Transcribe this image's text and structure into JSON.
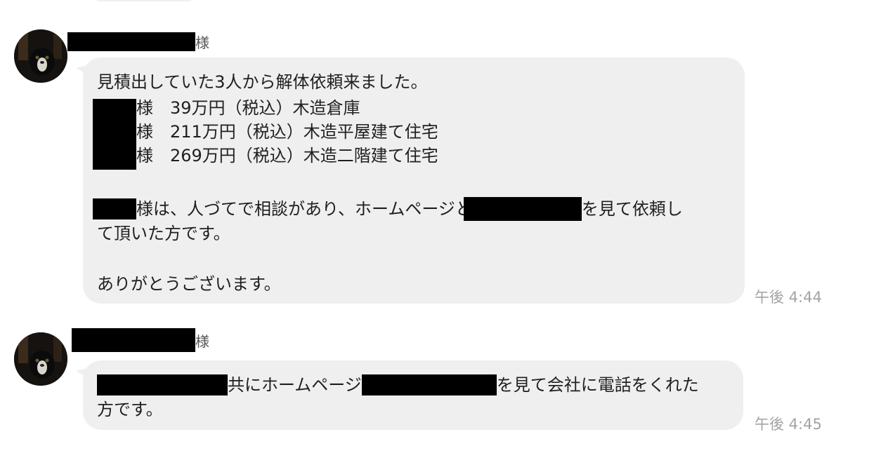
{
  "messages": [
    {
      "sender_suffix": "様",
      "lines": {
        "l1": "見積出していた3人から解体依頼来ました。",
        "l2": "様　39万円（税込）木造倉庫",
        "l3": "様　211万円（税込）木造平屋建て住宅",
        "l4": "様　269万円（税込）木造二階建て住宅",
        "l5a": "様は、人づてで相談があり、ホームページと",
        "l5b": "を見て依頼し",
        "l6": "て頂いた方です。",
        "l7": "ありがとうございます。"
      },
      "time": "午後 4:44"
    },
    {
      "sender_suffix": "様",
      "lines": {
        "l1a": "共にホームページ",
        "l1b": "を見て会社に電話をくれた",
        "l2": "方です。"
      },
      "time": "午後 4:45"
    }
  ]
}
